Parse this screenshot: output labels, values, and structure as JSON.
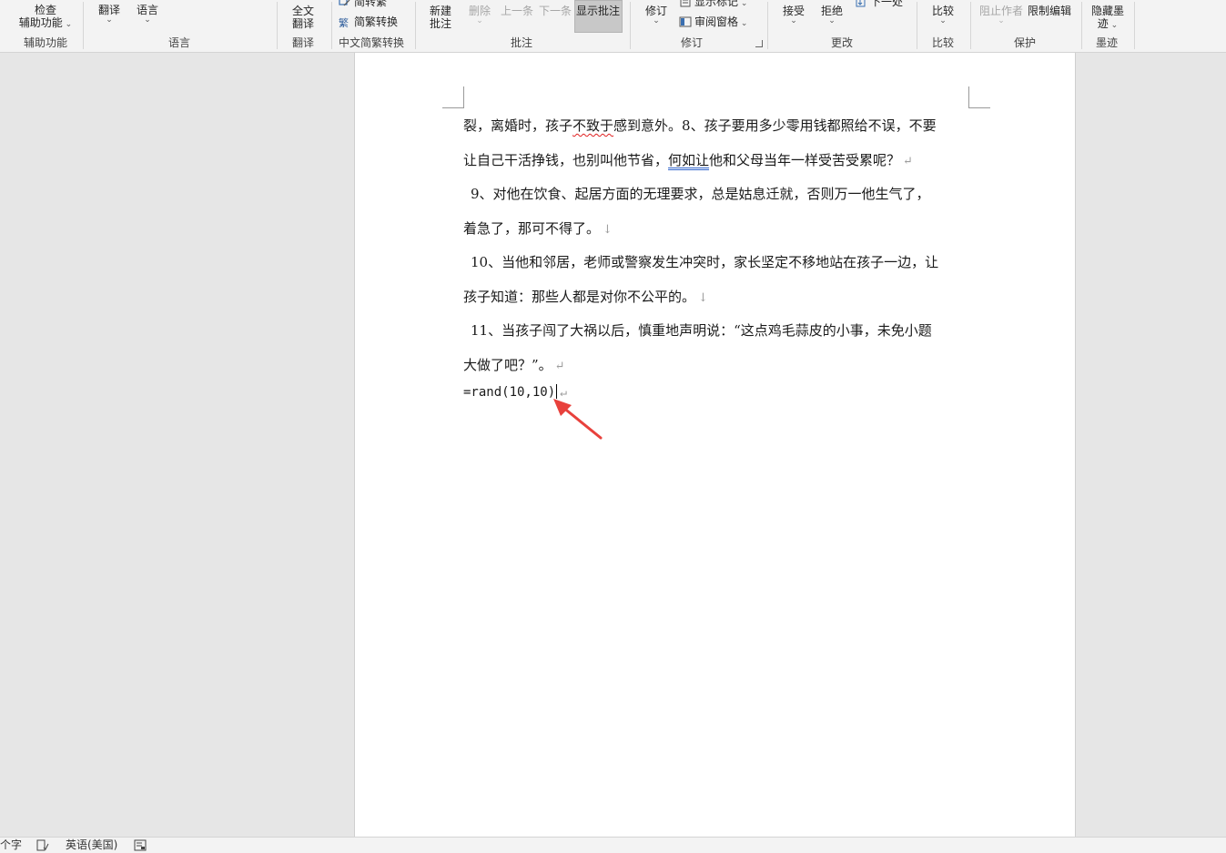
{
  "ribbon": {
    "accessibility": {
      "check_label_1": "检查",
      "check_label_2": "辅助功能",
      "group": "辅助功能"
    },
    "language": {
      "translate": "翻译",
      "language": "语言",
      "group": "语言"
    },
    "translate": {
      "full_1": "全文",
      "full_2": "翻译",
      "group": "翻译"
    },
    "chinese_conversion": {
      "to_simplified": "简转繁",
      "convert": "简繁转换",
      "group": "中文简繁转换"
    },
    "comments": {
      "new_1": "新建",
      "new_2": "批注",
      "delete": "删除",
      "previous": "上一条",
      "next": "下一条",
      "show": "显示批注",
      "group": "批注"
    },
    "tracking": {
      "track": "修订",
      "show_markup": "显示标记",
      "reviewing_pane": "审阅窗格",
      "group": "修订"
    },
    "changes": {
      "accept": "接受",
      "reject": "拒绝",
      "next": "下一处",
      "group": "更改"
    },
    "compare": {
      "compare": "比较",
      "group": "比较"
    },
    "protect": {
      "block_authors": "阻止作者",
      "restrict": "限制编辑",
      "group": "保护"
    },
    "ink": {
      "hide_1": "隐藏墨",
      "hide_2": "迹",
      "group": "墨迹"
    }
  },
  "document": {
    "line1": {
      "a": "裂，离婚时，孩子",
      "b": "不致于",
      "c": "感到意外。8、孩子要用多少零用钱都照给不误，不要"
    },
    "line2": {
      "a": "让自己干活挣钱，也别叫他节省，",
      "b": "何如让",
      "c": "他和父母当年一样受苦受累呢？"
    },
    "line3": "9、对他在饮食、起居方面的无理要求，总是姑息迁就，否则万一他生气了，",
    "line4": "着急了，那可不得了。",
    "line5": "10、当他和邻居，老师或警察发生冲突时，家长坚定不移地站在孩子一边，让",
    "line6": "孩子知道：那些人都是对你不公平的。",
    "line7": "11、当孩子闯了大祸以后，慎重地声明说：“这点鸡毛蒜皮的小事，未免小题",
    "line8": "大做了吧？”。",
    "formula": "=rand(10,10)",
    "paragraph_mark": "↵",
    "line_break_mark": "↓"
  },
  "statusbar": {
    "words": "个字",
    "language": "英语(美国)"
  },
  "colors": {
    "annotation_arrow": "#e8413c",
    "ribbon_bg": "#f3f3f3",
    "workspace_bg": "#e6e6e6"
  }
}
